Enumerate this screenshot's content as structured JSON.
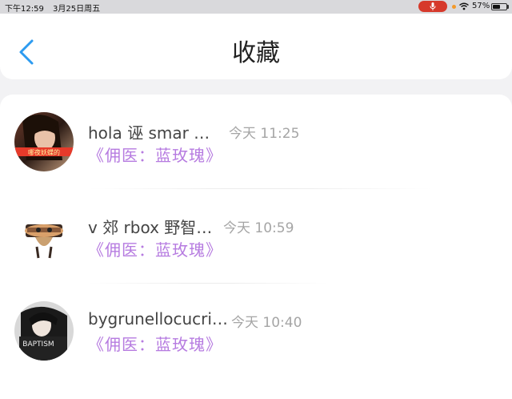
{
  "status_bar": {
    "time": "下午12:59",
    "date": "3月25日周五",
    "battery": "57%",
    "battery_level": 0.57,
    "mic_color": "#d6392b",
    "icons": [
      "mic-icon",
      "wifi-icon",
      "battery-icon"
    ]
  },
  "header": {
    "title": "收藏",
    "back_icon": "chevron-left-icon",
    "accent_color": "#2d9bf0"
  },
  "favorites": [
    {
      "name": "hola 诬 smar …",
      "time": "今天 11:25",
      "tag": "《佣医：蓝玫瑰》",
      "avatar_caption": "哪夜妖蝶的"
    },
    {
      "name": "v 郊 rbox 野智…",
      "time": "今天 10:59",
      "tag": "《佣医：蓝玫瑰》"
    },
    {
      "name": "bygrunellocucri…",
      "time": "今天 10:40",
      "tag": "《佣医：蓝玫瑰》",
      "avatar_caption": "BAPTISM"
    }
  ],
  "tag_color": "#b67be0"
}
